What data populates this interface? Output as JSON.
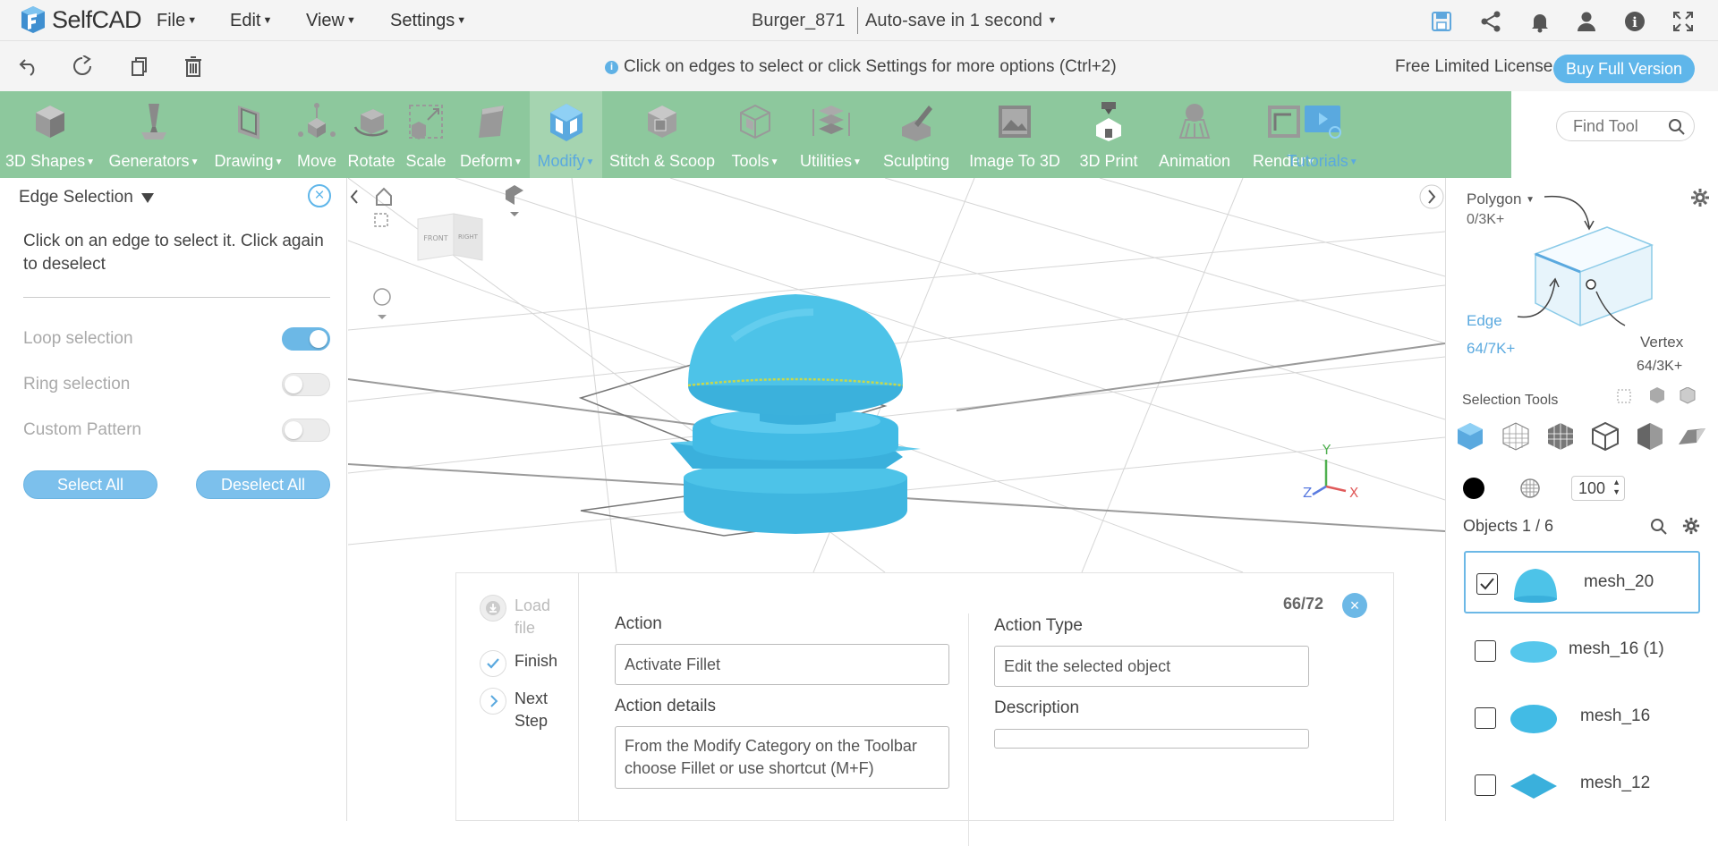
{
  "app": {
    "name": "SelfCAD",
    "filename": "Burger_871",
    "autosave": "Auto-save in 1 second"
  },
  "menu": [
    {
      "label": "File"
    },
    {
      "label": "Edit"
    },
    {
      "label": "View"
    },
    {
      "label": "Settings"
    }
  ],
  "hint": "Click on edges to select or click Settings for more options (Ctrl+2)",
  "license": {
    "text": "Free Limited License",
    "buy": "Buy Full Version"
  },
  "toolbar": [
    {
      "label": "3D Shapes",
      "dropdown": true
    },
    {
      "label": "Generators",
      "dropdown": true
    },
    {
      "label": "Drawing",
      "dropdown": true
    },
    {
      "label": "Move",
      "dropdown": false
    },
    {
      "label": "Rotate",
      "dropdown": false
    },
    {
      "label": "Scale",
      "dropdown": false
    },
    {
      "label": "Deform",
      "dropdown": true
    },
    {
      "label": "Modify",
      "dropdown": true,
      "active": true
    },
    {
      "label": "Stitch & Scoop",
      "dropdown": false
    },
    {
      "label": "Tools",
      "dropdown": true
    },
    {
      "label": "Utilities",
      "dropdown": true
    },
    {
      "label": "Sculpting",
      "dropdown": false
    },
    {
      "label": "Image To 3D",
      "dropdown": false
    },
    {
      "label": "3D Print",
      "dropdown": false
    },
    {
      "label": "Animation",
      "dropdown": false
    },
    {
      "label": "Render",
      "dropdown": true
    },
    {
      "label": "Tutorials",
      "dropdown": true
    }
  ],
  "find_tool": {
    "placeholder": "Find Tool"
  },
  "left_panel": {
    "title": "Edge Selection",
    "description": "Click on an edge to select it. Click again to deselect",
    "toggles": [
      {
        "label": "Loop selection",
        "on": true
      },
      {
        "label": "Ring selection",
        "on": false
      },
      {
        "label": "Custom Pattern",
        "on": false
      }
    ],
    "select_all": "Select All",
    "deselect_all": "Deselect All"
  },
  "viewport": {
    "cube_front": "FRONT",
    "cube_right": "RIGHT",
    "axis_y": "Y",
    "axis_x": "X",
    "axis_z": "Z",
    "colors": {
      "mesh": "#4dc3e8",
      "grid": "#d9d9d9",
      "axis_x": "#e05a5a",
      "axis_y": "#4fb04f",
      "axis_z": "#5a7be0"
    }
  },
  "tutorial": {
    "steps": [
      {
        "label": "Load file"
      },
      {
        "label": "Finish"
      },
      {
        "label": "Next Step"
      }
    ],
    "action_label": "Action",
    "action_value": "Activate Fillet",
    "details_label": "Action details",
    "details_value": "From the Modify Category on the Toolbar choose Fillet or use shortcut (M+F)",
    "type_label": "Action Type",
    "type_value": "Edit the selected object",
    "description_label": "Description",
    "description_value": "",
    "counter": "66/72"
  },
  "right_panel": {
    "mode": "Polygon",
    "polygon_count": "0/3K+",
    "edge_label": "Edge",
    "edge_count": "64/7K+",
    "vertex_label": "Vertex",
    "vertex_count": "64/3K+",
    "selection_tools": "Selection Tools",
    "opacity": "100",
    "objects_title": "Objects 1 / 6",
    "objects": [
      {
        "name": "mesh_20",
        "checked": true
      },
      {
        "name": "mesh_16 (1)",
        "checked": false
      },
      {
        "name": "mesh_16",
        "checked": false
      },
      {
        "name": "mesh_12",
        "checked": false
      }
    ]
  },
  "colors": {
    "accent": "#5fb6ea",
    "toolbar": "#8dc89d",
    "mesh": "#4dc3e8"
  }
}
